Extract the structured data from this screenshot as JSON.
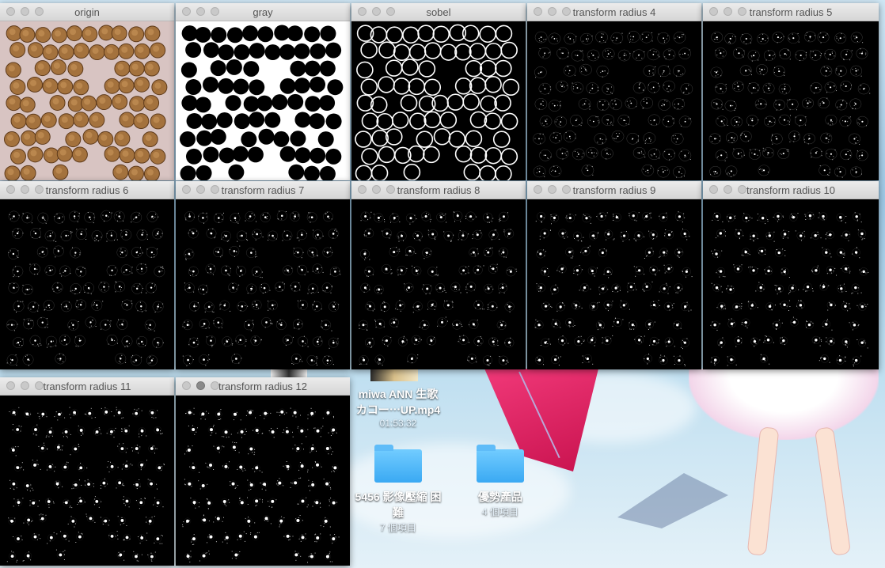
{
  "desktop": {
    "icons": [
      {
        "label": "miwa ANN 生歌",
        "label2": "カコー⋯UP.mp4",
        "sub": "01:53:32"
      },
      {
        "label": "5456 影像壓縮 困",
        "label2": "難",
        "sub": "7 個項目"
      },
      {
        "label": "優勢產品",
        "label2": "",
        "sub": "4 個項目"
      }
    ]
  },
  "windows": [
    {
      "title": "origin"
    },
    {
      "title": "gray"
    },
    {
      "title": "sobel"
    },
    {
      "title": "transform radius 4"
    },
    {
      "title": "transform radius 5"
    },
    {
      "title": "transform radius 6"
    },
    {
      "title": "transform radius 7"
    },
    {
      "title": "transform radius 8"
    },
    {
      "title": "transform radius 9"
    },
    {
      "title": "transform radius 10"
    },
    {
      "title": "transform radius 11"
    },
    {
      "title": "transform radius 12"
    }
  ],
  "colors": {
    "window_bg": "#000000",
    "titlebar": "#dcdcdc",
    "coin_copper": "#a4723d",
    "desk_sky": "#9ec9e6",
    "folder_blue": "#4fb6f6"
  }
}
